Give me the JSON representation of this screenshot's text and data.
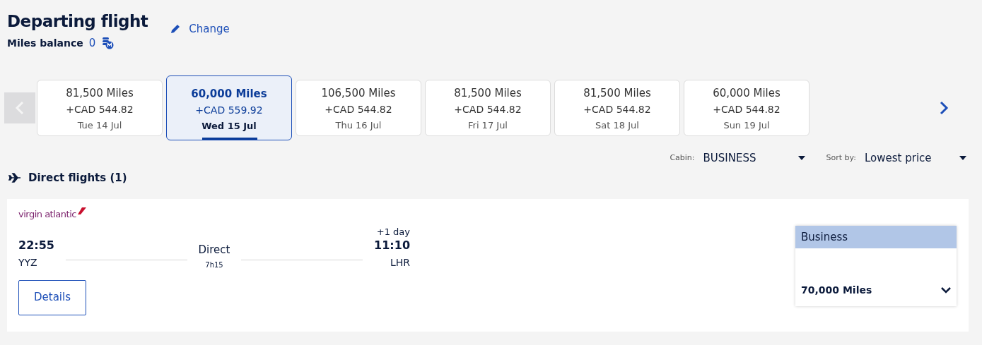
{
  "header": {
    "title": "Departing flight",
    "change_link": "Change",
    "balance_label": "Miles balance",
    "balance_value": "0"
  },
  "date_nav": {
    "prev_disabled": true,
    "next_disabled": false,
    "dates": [
      {
        "miles": "81,500 Miles",
        "price": "+CAD 544.82",
        "date": "Tue 14 Jul",
        "selected": false
      },
      {
        "miles": "60,000 Miles",
        "price": "+CAD 559.92",
        "date": "Wed 15 Jul",
        "selected": true
      },
      {
        "miles": "106,500 Miles",
        "price": "+CAD 544.82",
        "date": "Thu 16 Jul",
        "selected": false
      },
      {
        "miles": "81,500 Miles",
        "price": "+CAD 544.82",
        "date": "Fri 17 Jul",
        "selected": false
      },
      {
        "miles": "81,500 Miles",
        "price": "+CAD 544.82",
        "date": "Sat 18 Jul",
        "selected": false
      },
      {
        "miles": "60,000 Miles",
        "price": "+CAD 544.82",
        "date": "Sun 19 Jul",
        "selected": false
      }
    ]
  },
  "filters": [
    {
      "label": "Cabin:",
      "value": "BUSINESS"
    },
    {
      "label": "Sort by:",
      "value": "Lowest price"
    }
  ],
  "section_title": "Direct flights (1)",
  "flight": {
    "airline": "virgin atlantic",
    "depart_time": "22:55",
    "depart_airport": "YYZ",
    "stops": "Direct",
    "duration": "7h15",
    "day_offset": "+1 day",
    "arrive_time": "11:10",
    "arrive_airport": "LHR",
    "details_button": "Details",
    "fare": {
      "cabin": "Business",
      "miles": "70,000 Miles"
    }
  }
}
